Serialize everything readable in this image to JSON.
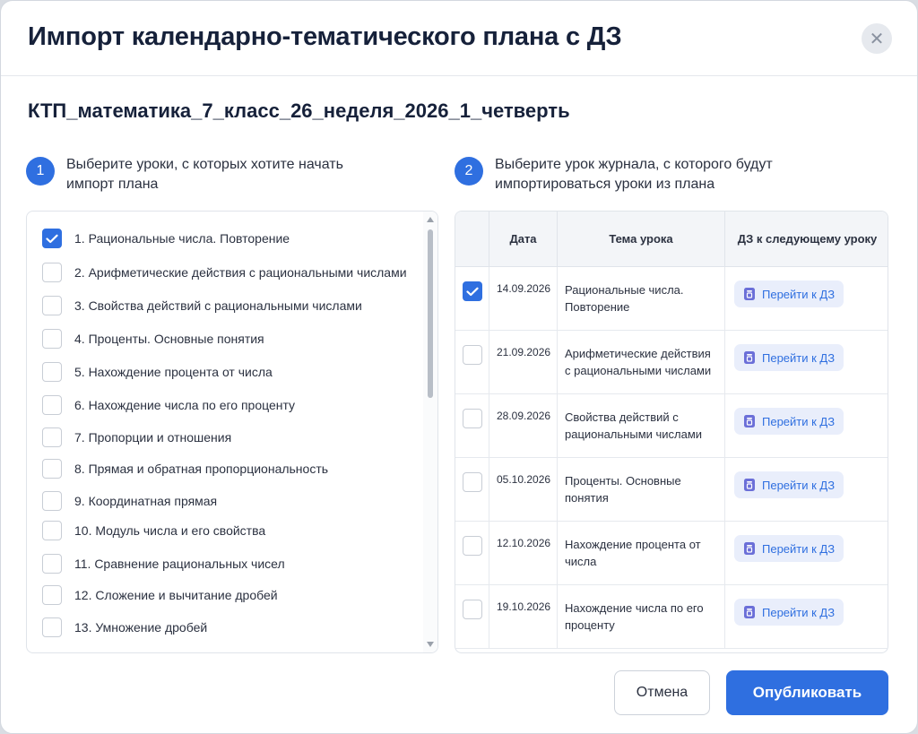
{
  "dialog": {
    "title": "Импорт календарно-тематического плана с ДЗ",
    "close_icon": "close-icon",
    "filename": "КТП_математика_7_класс_26_неделя_2026_1_четверть"
  },
  "step1": {
    "number": "1",
    "text": "Выберите уроки, с которых хотите начать импорт плана"
  },
  "step2": {
    "number": "2",
    "text": "Выберите урок журнала, с которого будут импортироваться уроки из плана"
  },
  "lessons": [
    {
      "label": "1.  Рациональные числа. Повторение",
      "checked": true
    },
    {
      "label": "2.  Арифметические действия с рациональными числами",
      "checked": false
    },
    {
      "label": "3.  Свойства действий с рациональными числами",
      "checked": false
    },
    {
      "label": "4.  Проценты. Основные понятия",
      "checked": false
    },
    {
      "label": "5.  Нахождение процента от числа",
      "checked": false
    },
    {
      "label": "6.  Нахождение числа по его проценту",
      "checked": false
    },
    {
      "label": "7.  Пропорции и отношения",
      "checked": false
    },
    {
      "label": "8.  Прямая и обратная пропорциональность",
      "checked": false
    },
    {
      "label": "9.  Координатная прямая",
      "checked": false
    },
    {
      "label": "10.  Модуль числа и его свойства",
      "checked": false
    },
    {
      "label": "11.  Сравнение рациональных чисел",
      "checked": false
    },
    {
      "label": "12.  Сложение и вычитание дробей",
      "checked": false
    },
    {
      "label": "13.  Умножение дробей",
      "checked": false
    }
  ],
  "table": {
    "headers": {
      "date": "Дата",
      "topic": "Тема урока",
      "homework": "ДЗ к следующему уроку"
    },
    "rows": [
      {
        "date": "14.09.2026",
        "topic": "Рациональные числа. Повторение",
        "hw": "Перейти к ДЗ",
        "checked": true
      },
      {
        "date": "21.09.2026",
        "topic": "Арифметические действия с рациональными числами",
        "hw": "Перейти к ДЗ",
        "checked": false
      },
      {
        "date": "28.09.2026",
        "topic": "Свойства действий с рациональными числами",
        "hw": "Перейти к ДЗ",
        "checked": false
      },
      {
        "date": "05.10.2026",
        "topic": "Проценты. Основные понятия",
        "hw": "Перейти к ДЗ",
        "checked": false
      },
      {
        "date": "12.10.2026",
        "topic": "Нахождение процента от числа",
        "hw": "Перейти к ДЗ",
        "checked": false
      },
      {
        "date": "19.10.2026",
        "topic": "Нахождение числа по его проценту",
        "hw": "Перейти к ДЗ",
        "checked": false
      }
    ]
  },
  "footer": {
    "cancel_label": "Отмена",
    "publish_label": "Опубликовать"
  },
  "colors": {
    "accent": "#2f6fe0",
    "hw_button_bg": "#e9eefb"
  }
}
